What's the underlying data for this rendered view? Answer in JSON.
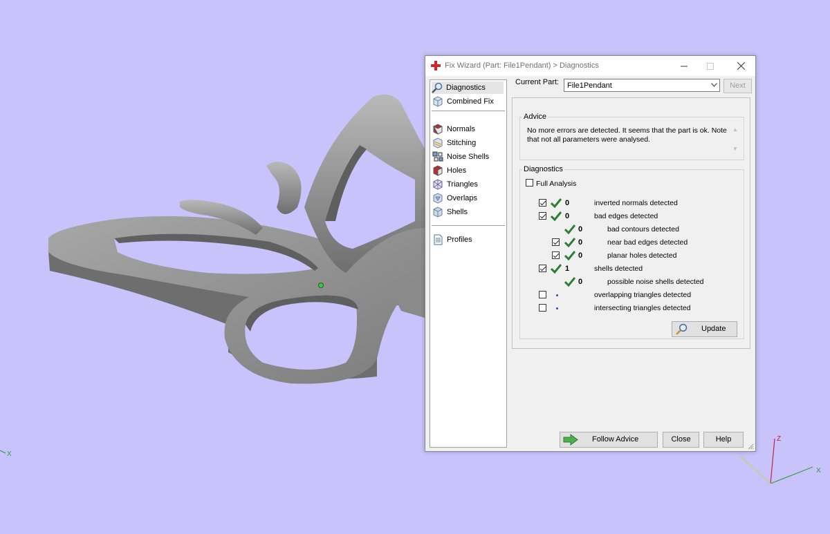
{
  "window": {
    "title": "Fix Wizard (Part: File1Pendant) > Diagnostics"
  },
  "nav": {
    "items": [
      {
        "label": "Diagnostics",
        "icon": "magnifier-icon",
        "selected": true
      },
      {
        "label": "Combined Fix",
        "icon": "cube-icon"
      },
      {
        "label": "Normals",
        "icon": "normals-cube-icon"
      },
      {
        "label": "Stitching",
        "icon": "stitching-icon"
      },
      {
        "label": "Noise Shells",
        "icon": "noise-shells-icon"
      },
      {
        "label": "Holes",
        "icon": "holes-cube-icon"
      },
      {
        "label": "Triangles",
        "icon": "triangles-icon"
      },
      {
        "label": "Overlaps",
        "icon": "overlaps-icon"
      },
      {
        "label": "Shells",
        "icon": "shells-icon"
      },
      {
        "label": "Profiles",
        "icon": "document-icon"
      }
    ]
  },
  "part": {
    "label": "Current Part:",
    "value": "File1Pendant",
    "next_label": "Next"
  },
  "advice": {
    "legend": "Advice",
    "text": "No more errors are detected. It seems that the part is ok. Note that not all parameters were analysed."
  },
  "diagnostics": {
    "legend": "Diagnostics",
    "full_analysis_label": "Full Analysis",
    "full_analysis_checked": false,
    "rows": [
      {
        "checkbox": true,
        "checked": true,
        "status": "ok",
        "count": "0",
        "label": "inverted normals detected",
        "indent": 0
      },
      {
        "checkbox": true,
        "checked": true,
        "status": "ok",
        "count": "0",
        "label": "bad edges detected",
        "indent": 0
      },
      {
        "checkbox": false,
        "checked": false,
        "status": "ok",
        "count": "0",
        "label": "bad contours detected",
        "indent": 1
      },
      {
        "checkbox": true,
        "checked": true,
        "status": "ok",
        "count": "0",
        "label": "near bad edges detected",
        "indent": 1
      },
      {
        "checkbox": true,
        "checked": true,
        "status": "ok",
        "count": "0",
        "label": "planar holes detected",
        "indent": 1
      },
      {
        "checkbox": true,
        "checked": true,
        "status": "ok",
        "count": "1",
        "label": "shells detected",
        "indent": 0
      },
      {
        "checkbox": false,
        "checked": false,
        "status": "ok",
        "count": "0",
        "label": "possible noise shells detected",
        "indent": 1
      },
      {
        "checkbox": true,
        "checked": false,
        "status": "none",
        "count": "",
        "label": "overlapping triangles detected",
        "indent": 0
      },
      {
        "checkbox": true,
        "checked": false,
        "status": "none",
        "count": "",
        "label": "intersecting triangles detected",
        "indent": 0
      }
    ],
    "update_label": "Update"
  },
  "footer": {
    "follow_label": "Follow Advice",
    "close_label": "Close",
    "help_label": "Help"
  },
  "colors": {
    "viewport_bg": "#c8c4fb",
    "model_gray": "#8f8f8f",
    "check_green": "#2e7d32",
    "axis_x": "#2e9c3e",
    "axis_y": "#3a9c3e",
    "axis_z": "#c02040"
  },
  "axes": {
    "x_label": "X",
    "z_label": "Z",
    "x_label_left": "X"
  }
}
